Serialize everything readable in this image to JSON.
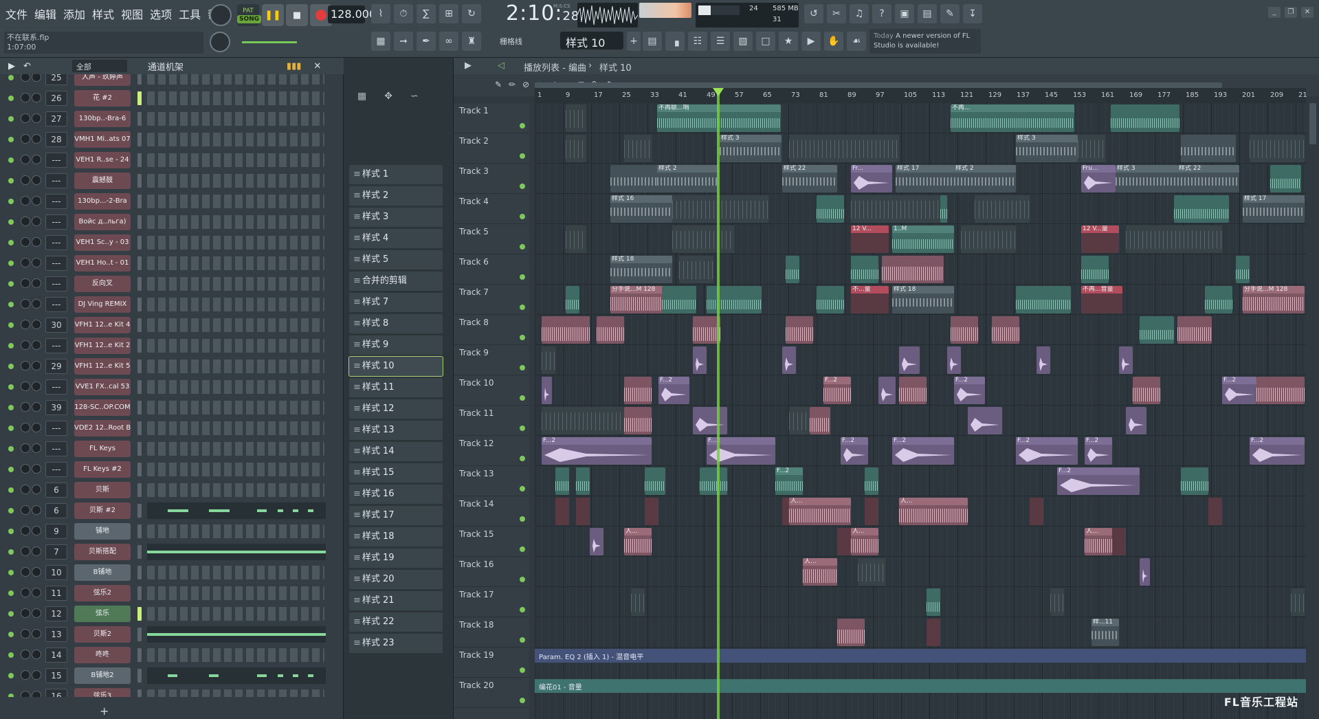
{
  "menu": [
    "文件",
    "编辑",
    "添加",
    "样式",
    "视图",
    "选项",
    "工具",
    "帮助"
  ],
  "file": {
    "name": "不在联系.flp",
    "position": "1:07:00"
  },
  "transport": {
    "pat_label": "PAT",
    "song_label": "SONG",
    "tempo": "128.000",
    "time_main": "2:10",
    "time_sub": "28",
    "time_unit": "M:S:CS"
  },
  "cpu": {
    "polyphony": "24",
    "memory": "585 MB",
    "cpu_value": "31"
  },
  "snap": "栅格线",
  "current_pattern": "样式 10",
  "hint": {
    "date": "Today",
    "text": "A newer version of FL Studio is available!"
  },
  "rack": {
    "filter": "全部",
    "title": "通道机架",
    "add_label": "+",
    "channels": [
      {
        "num": "25",
        "name": "人声 - 玖婷声",
        "type": "pink"
      },
      {
        "num": "26",
        "name": "花 #2",
        "type": "pink"
      },
      {
        "num": "27",
        "name": "130bp..-Bra-6",
        "type": "pink"
      },
      {
        "num": "28",
        "name": "VMH1 Mi..ats 07",
        "type": "pink"
      },
      {
        "num": "---",
        "name": "VEH1 R..se - 24",
        "type": "pink"
      },
      {
        "num": "---",
        "name": "震撼鼓",
        "type": "pink"
      },
      {
        "num": "---",
        "name": "130bp...-2-Bra",
        "type": "pink"
      },
      {
        "num": "---",
        "name": "Войс д..льга)",
        "type": "pink"
      },
      {
        "num": "---",
        "name": "VEH1 Sc..y - 03",
        "type": "pink"
      },
      {
        "num": "---",
        "name": "VEH1 Ho..t - 01",
        "type": "pink"
      },
      {
        "num": "---",
        "name": "反向叉",
        "type": "pink"
      },
      {
        "num": "---",
        "name": "DJ Ving REMIX",
        "type": "pink"
      },
      {
        "num": "30",
        "name": "VFH1 12..e Kit 4",
        "type": "pink"
      },
      {
        "num": "---",
        "name": "VFH1 12..e Kit 2",
        "type": "pink"
      },
      {
        "num": "29",
        "name": "VFH1 12..e Kit 5",
        "type": "pink"
      },
      {
        "num": "---",
        "name": "VVE1 FX..cal 53",
        "type": "pink"
      },
      {
        "num": "39",
        "name": "128-SC..OP.COM",
        "type": "pink"
      },
      {
        "num": "---",
        "name": "VDE2 12..Root B",
        "type": "pink"
      },
      {
        "num": "---",
        "name": "FL Keys",
        "type": "pink"
      },
      {
        "num": "---",
        "name": "FL Keys #2",
        "type": "pink"
      },
      {
        "num": "6",
        "name": "贝斯",
        "type": "pink"
      },
      {
        "num": "6",
        "name": "贝斯 #2",
        "type": "pink"
      },
      {
        "num": "9",
        "name": "铺地",
        "type": "gray"
      },
      {
        "num": "7",
        "name": "贝斯搭配",
        "type": "pink"
      },
      {
        "num": "10",
        "name": "B铺地",
        "type": "gray"
      },
      {
        "num": "11",
        "name": "弦乐2",
        "type": "pink"
      },
      {
        "num": "12",
        "name": "弦乐",
        "type": "green"
      },
      {
        "num": "13",
        "name": "贝斯2",
        "type": "pink"
      },
      {
        "num": "14",
        "name": "咚咚",
        "type": "pink"
      },
      {
        "num": "15",
        "name": "B铺地2",
        "type": "gray"
      },
      {
        "num": "16",
        "name": "弦乐3",
        "type": "pink"
      }
    ]
  },
  "patterns": [
    "样式 1",
    "样式 2",
    "样式 3",
    "样式 4",
    "样式 5",
    "合并的剪辑",
    "样式 7",
    "样式 8",
    "样式 9",
    "样式 10",
    "样式 11",
    "样式 12",
    "样式 13",
    "样式 14",
    "样式 15",
    "样式 16",
    "样式 17",
    "样式 18",
    "样式 19",
    "样式 20",
    "样式 21",
    "样式 22",
    "样式 23"
  ],
  "selected_pattern_index": 9,
  "playlist": {
    "title": "播放列表 - 编曲",
    "breadcrumb": "样式 10",
    "ruler": [
      "1",
      "9",
      "17",
      "25",
      "33",
      "41",
      "49",
      "57",
      "65",
      "73",
      "81",
      "89",
      "97",
      "105",
      "113",
      "121",
      "129",
      "137",
      "145",
      "153",
      "161",
      "169",
      "177",
      "185",
      "193",
      "201",
      "209",
      "21"
    ],
    "tracks": [
      "Track 1",
      "Track 2",
      "Track 3",
      "Track 4",
      "Track 5",
      "Track 6",
      "Track 7",
      "Track 8",
      "Track 9",
      "Track 10",
      "Track 11",
      "Track 12",
      "Track 13",
      "Track 14",
      "Track 15",
      "Track 16",
      "Track 17",
      "Track 18",
      "Track 19",
      "Track 20"
    ],
    "clip_labels": {
      "t1a": "不再联...哨",
      "t1b": "不再...",
      "t2a": "样式 3",
      "t2b": "样式 3",
      "t3a": "样式 2",
      "t3b": "样式 22",
      "t3c": "Fr...",
      "t3d": "样式 17",
      "t3e": "样式 2",
      "t3f": "Fru...",
      "t3g": "样式 3",
      "t3h": "样式 22",
      "t4a": "样式 16",
      "t4b": "样式 17",
      "t5a": "12 V...",
      "t5b": "1..M",
      "t5c": "12 V...量",
      "t6a": "样式 18",
      "t7a": "分手说...M 128",
      "t7b": "不...量",
      "t7c": "样式 18",
      "t7d": "不再...音量",
      "t7e": "分手说...M 128",
      "f2": "F...2",
      "ren": "人...",
      "t18": "样...11",
      "t19": "Param. EQ 2 (插入 1) - 混音电平",
      "t20": "编花01 - 音量"
    }
  },
  "watermark": "FL音乐工程站"
}
